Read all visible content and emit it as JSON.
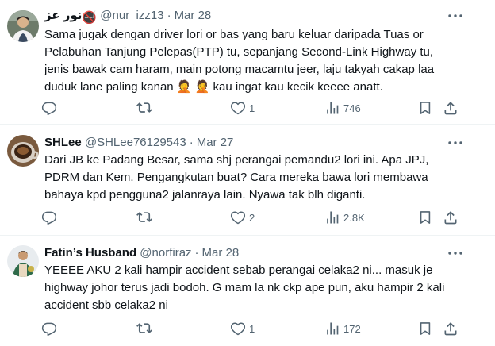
{
  "tweets": [
    {
      "display_name": "نور عز",
      "display_name_emoji": "🚭",
      "handle": "@nur_izz13",
      "date": "Mar 28",
      "text_lines": [
        "Sama jugak dengan driver lori or bas yang baru keluar daripada Tuas or",
        "Pelabuhan Tanjung Pelepas(PTP) tu, sepanjang Second-Link Highway tu,",
        "jenis bawak cam haram, main potong macamtu jeer, laju takyah cakap laa",
        "duduk lane paling kanan",
        "kau ingat kau kecik keeee anatt."
      ],
      "text_emoji": "🤦 🤦",
      "replies": "",
      "retweets": "",
      "likes": "1",
      "views": "746"
    },
    {
      "display_name": "SHLee",
      "handle": "@SHLee76129543",
      "date": "Mar 27",
      "text_lines": [
        "Dari JB ke Padang Besar, sama shj perangai pemandu2 lori ini.  Apa JPJ,",
        "PDRM dan Kem. Pengangkutan buat? Cara mereka bawa lori membawa",
        "bahaya kpd pengguna2 jalanraya lain. Nyawa tak blh diganti."
      ],
      "replies": "",
      "retweets": "",
      "likes": "2",
      "views": "2.8K"
    },
    {
      "display_name": "Fatin’s Husband",
      "handle": "@norfiraz",
      "date": "Mar 28",
      "text_lines": [
        "YEEEE AKU 2 kali hampir accident sebab perangai celaka2 ni... masuk je",
        "highway johor terus jadi bodoh. G mam la nk ckp ape pun, aku hampir 2 kali",
        "accident sbb celaka2 ni"
      ],
      "replies": "",
      "retweets": "",
      "likes": "1",
      "views": "172"
    }
  ],
  "colors": {
    "text": "#0f1419",
    "secondary": "#536471",
    "divider": "#eff3f4"
  },
  "icons": [
    "more-icon",
    "reply-icon",
    "retweet-icon",
    "like-icon",
    "views-icon",
    "bookmark-icon",
    "share-icon"
  ]
}
